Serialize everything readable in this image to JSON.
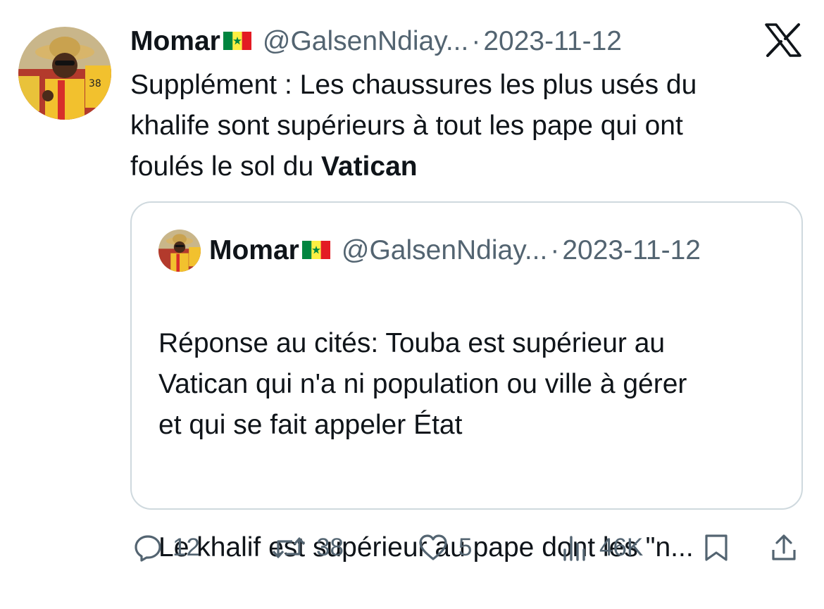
{
  "tweet": {
    "author_name": "Momar",
    "author_flag": "senegal-flag",
    "author_handle": "@GalsenNdiay...",
    "separator": "·",
    "date": "2023-11-12",
    "text_before_bold": "Supplément : Les chaussures les plus usés du\nkhalife sont supérieurs à tout les pape qui ont\nfoulés le sol du ",
    "text_bold": "Vatican"
  },
  "quoted": {
    "author_name": "Momar",
    "author_flag": "senegal-flag",
    "author_handle": "@GalsenNdiay...",
    "separator": "·",
    "date": "2023-11-12",
    "paragraph1": "Réponse au cités: Touba est supérieur au\nVatican qui n'a ni population ou ville à gérer\net qui se fait appeler État",
    "paragraph2": "Le khalif est supérieur au pape dont les \"n..."
  },
  "actions": {
    "replies": "12",
    "reposts": "38",
    "likes": "5",
    "views": "46K"
  },
  "brand_icon": "x-logo",
  "colors": {
    "text": "#0f1419",
    "secondary": "#536471",
    "border": "#cfd9de",
    "flag_green": "#00853f",
    "flag_yellow": "#fdef42",
    "flag_red": "#e31b23"
  }
}
